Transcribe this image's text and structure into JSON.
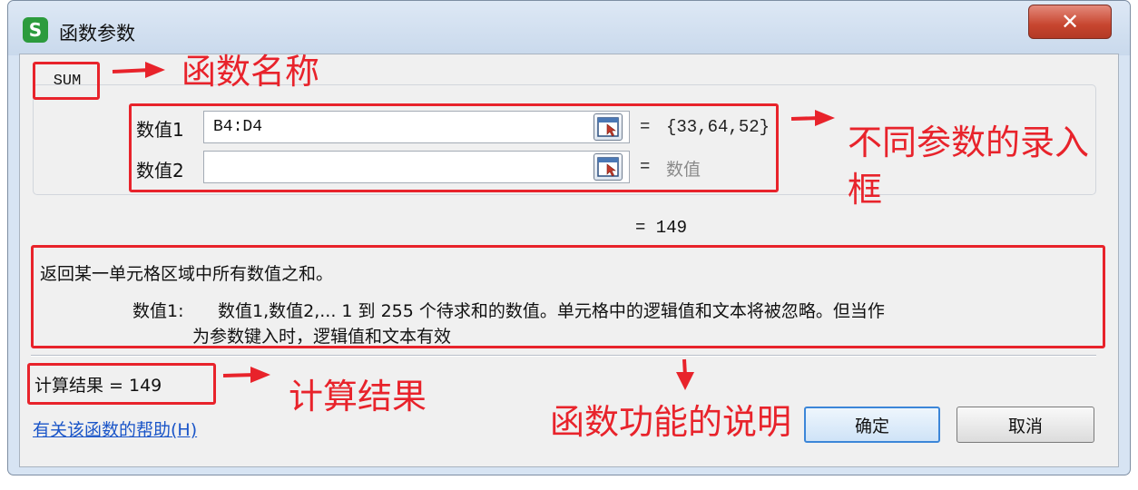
{
  "window": {
    "title": "函数参数",
    "app_icon_glyph": "S",
    "close_glyph": "✕"
  },
  "function_name": "SUM",
  "args": [
    {
      "label": "数值1",
      "value": "B4:D4",
      "eq": "=",
      "result": "{33,64,52}"
    },
    {
      "label": "数值2",
      "value": "",
      "eq": "=",
      "result": "数值"
    }
  ],
  "formula_result": "= 149",
  "description": {
    "main": "返回某一单元格区域中所有数值之和。",
    "param_label": "数值1:",
    "param_text_1": "数值1,数值2,... 1 到 255 个待求和的数值。单元格中的逻辑值和文本将被忽略。但当作",
    "param_text_2": "为参数键入时，逻辑值和文本有效"
  },
  "calc_result": "计算结果 = 149",
  "help_link": "有关该函数的帮助(H)",
  "buttons": {
    "ok": "确定",
    "cancel": "取消"
  },
  "annotations": {
    "func_name": "函数名称",
    "inputs_line1": "不同参数的录入",
    "inputs_line2": "框",
    "calc": "计算结果",
    "desc": "函数功能的说明"
  },
  "colors": {
    "annotation_red": "#e8232b",
    "link_blue": "#1a55c8",
    "ok_border": "#3c86d8"
  },
  "icons": [
    "app-logo-icon",
    "close-icon",
    "range-select-icon",
    "arrow-icon"
  ]
}
